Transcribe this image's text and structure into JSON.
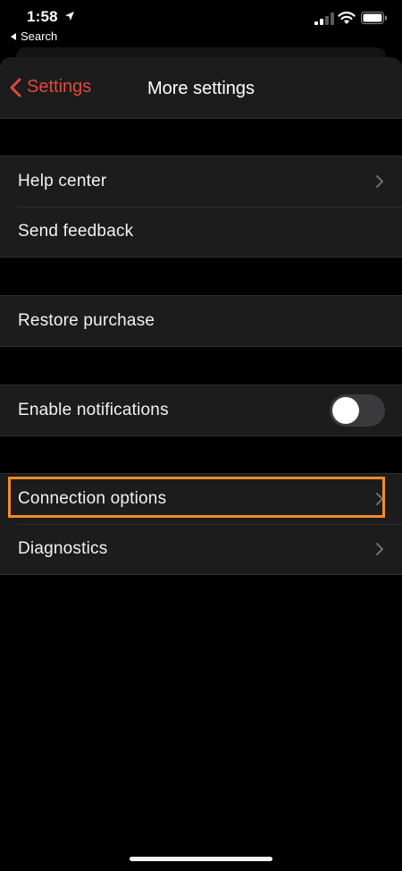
{
  "status_bar": {
    "time": "1:58",
    "back_app_label": "Search"
  },
  "nav": {
    "back_label": "Settings",
    "title": "More settings"
  },
  "groups": {
    "help": {
      "items": [
        {
          "label": "Help center",
          "has_chevron": true
        },
        {
          "label": "Send feedback",
          "has_chevron": false
        }
      ]
    },
    "purchase": {
      "items": [
        {
          "label": "Restore purchase",
          "has_chevron": false
        }
      ]
    },
    "notifications": {
      "label": "Enable notifications",
      "toggle_on": false
    },
    "connection": {
      "items": [
        {
          "label": "Connection options",
          "has_chevron": true,
          "highlighted": true
        },
        {
          "label": "Diagnostics",
          "has_chevron": true
        }
      ]
    }
  },
  "colors": {
    "accent": "#e2483f",
    "highlight": "#f28a2e",
    "background": "#000000",
    "cell": "#1c1c1c"
  }
}
